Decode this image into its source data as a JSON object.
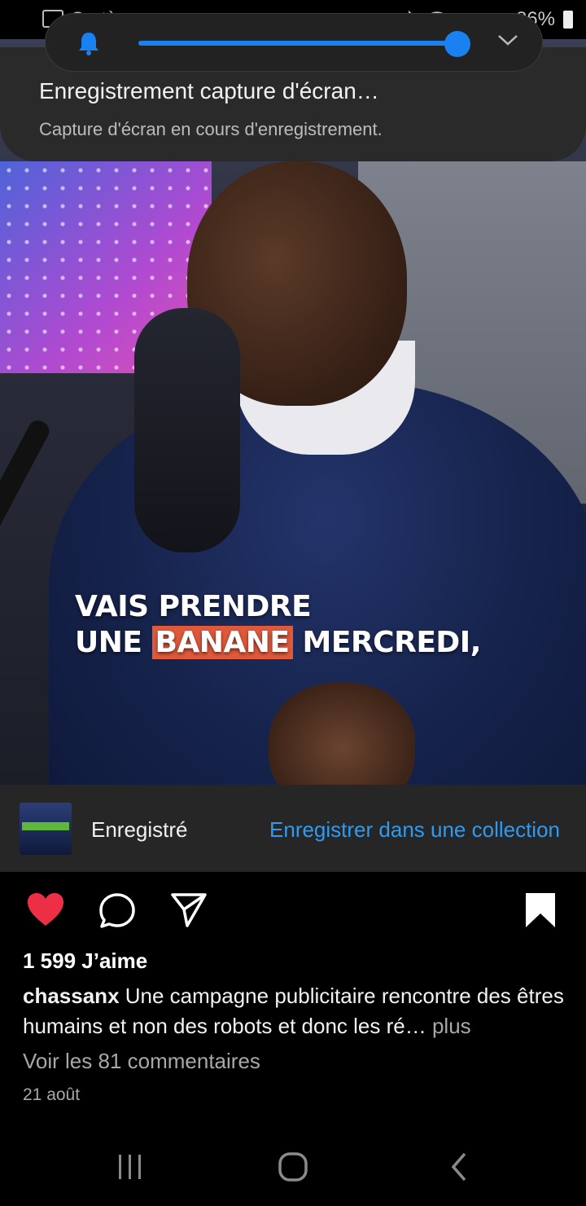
{
  "status_bar": {
    "system_label": "Système",
    "battery": "86%"
  },
  "volume_slider": {
    "level": 1.0,
    "accent": "#1a82f0"
  },
  "notification": {
    "title": "Enregistrement capture d'écran…",
    "subtitle": "Capture d'écran en cours d'enregistrement."
  },
  "video": {
    "caption_line1": "VAIS PRENDRE",
    "caption_line2_prefix": "UNE ",
    "caption_line2_highlight": "BANANE",
    "caption_line2_suffix": " MERCREDI,"
  },
  "saved_bar": {
    "saved_label": "Enregistré",
    "collection_link": "Enregistrer dans une collection"
  },
  "actions": {
    "icons": [
      "heart-icon",
      "comment-icon",
      "share-icon",
      "bookmark-icon"
    ]
  },
  "post": {
    "likes": "1 599 J’aime",
    "username": "chassanx",
    "caption": " Une campagne publicitaire rencontre des êtres humains et non des robots et donc les ré…",
    "more": " plus",
    "comments_link": "Voir les 81 commentaires",
    "date": "21 août"
  },
  "colors": {
    "like_red": "#ed2f46",
    "link_blue": "#2f9bf0",
    "highlight": "#e0593a"
  }
}
